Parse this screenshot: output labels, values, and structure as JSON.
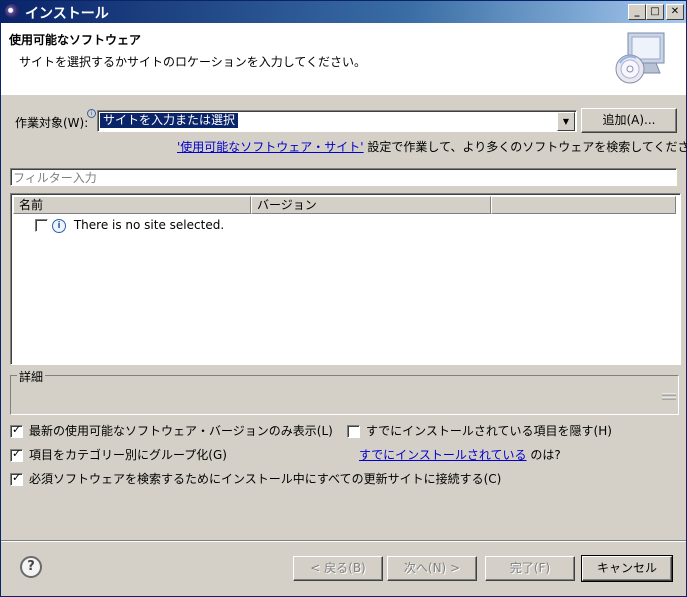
{
  "window": {
    "title": "インストール",
    "controls": [
      "_",
      "□",
      "✕"
    ]
  },
  "header": {
    "title": "使用可能なソフトウェア",
    "description": "サイトを選択するかサイトのロケーションを入力してください。"
  },
  "work_with": {
    "label": "作業対象(W):",
    "value": "サイトを入力または選択",
    "add_button": "追加(A)..."
  },
  "link_line": {
    "link": "'使用可能なソフトウェア・サイト'",
    "rest": " 設定で作業して、より多くのソフトウェアを検索してください。"
  },
  "filter": {
    "placeholder": "フィルター入力"
  },
  "table": {
    "columns": [
      "名前",
      "バージョン",
      ""
    ],
    "rows": [
      {
        "text": "There is no site selected."
      }
    ]
  },
  "details": {
    "label": "詳細"
  },
  "options": {
    "latest_only": "最新の使用可能なソフトウェア・バージョンのみ表示(L)",
    "hide_installed": "すでにインストールされている項目を隠す(H)",
    "group_by_category": "項目をカテゴリー別にグループ化(G)",
    "already_installed_link": "すでにインストールされている",
    "already_installed_suffix": " のは?",
    "contact_all_sites": "必須ソフトウェアを検索するためにインストール中にすべての更新サイトに接続する(C)"
  },
  "buttons": {
    "back": "< 戻る(B)",
    "next": "次へ(N) >",
    "finish": "完了(F)",
    "cancel": "キャンセル"
  }
}
